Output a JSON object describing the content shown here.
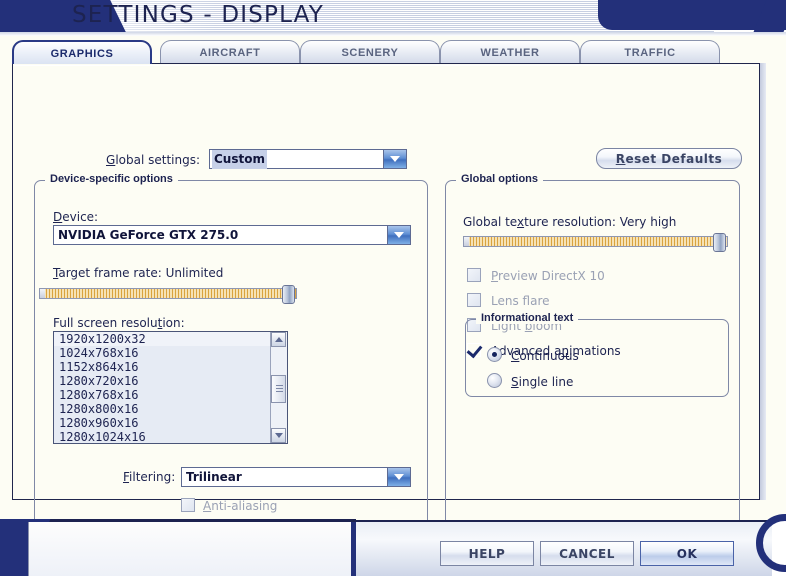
{
  "window": {
    "title": "SETTINGS - DISPLAY"
  },
  "tabs": [
    {
      "label": "GRAPHICS",
      "active": true
    },
    {
      "label": "AIRCRAFT",
      "active": false
    },
    {
      "label": "SCENERY",
      "active": false
    },
    {
      "label": "WEATHER",
      "active": false
    },
    {
      "label": "TRAFFIC",
      "active": false
    }
  ],
  "global_settings": {
    "label": "Global settings:",
    "accesskey": "G",
    "value": "Custom"
  },
  "reset_defaults": {
    "label": "Reset Defaults",
    "accesskey": "R"
  },
  "device_group": {
    "title": "Device-specific options",
    "device": {
      "label": "Device:",
      "accesskey": "D",
      "value": "NVIDIA GeForce GTX 275.0"
    },
    "target_frame_rate": {
      "label": "Target frame rate: Unlimited",
      "accesskey": "T",
      "value": "Unlimited",
      "slider_percent": 100
    },
    "full_screen_resolution": {
      "label": "Full screen resolution:",
      "accesskey": "t",
      "options": [
        "1920x1200x32",
        "1024x768x16",
        "1152x864x16",
        "1280x720x16",
        "1280x768x16",
        "1280x800x16",
        "1280x960x16",
        "1280x1024x16"
      ],
      "selected_index": 0
    },
    "filtering": {
      "label": "Filtering:",
      "accesskey": "F",
      "value": "Trilinear"
    },
    "anti_aliasing": {
      "label": "Anti-aliasing",
      "accesskey": "A",
      "checked": false,
      "enabled": false
    }
  },
  "global_options_group": {
    "title": "Global options",
    "texture_resolution": {
      "label": "Global texture resolution: Very high",
      "value": "Very high",
      "slider_percent": 100
    },
    "checkboxes": [
      {
        "label": "Preview DirectX 10",
        "checked": false,
        "enabled": false
      },
      {
        "label": "Lens flare",
        "checked": false,
        "enabled": false
      },
      {
        "label": "Light bloom",
        "checked": false,
        "enabled": false
      },
      {
        "label": "Advanced animations",
        "checked": true,
        "enabled": true
      }
    ],
    "informational_text": {
      "title": "Informational text",
      "options": [
        {
          "label": "Continuous",
          "selected": true
        },
        {
          "label": "Single line",
          "selected": false
        }
      ]
    }
  },
  "footer": {
    "buttons": [
      {
        "label": "HELP",
        "primary": false
      },
      {
        "label": "CANCEL",
        "primary": false
      },
      {
        "label": "OK",
        "primary": true
      }
    ]
  },
  "colors": {
    "brand_blue": "#23307a",
    "panel_bg": "#fdfdf4",
    "text": "#1d2350",
    "slider_gold": "#d9a33f",
    "disabled_text": "#9aa1b4"
  }
}
